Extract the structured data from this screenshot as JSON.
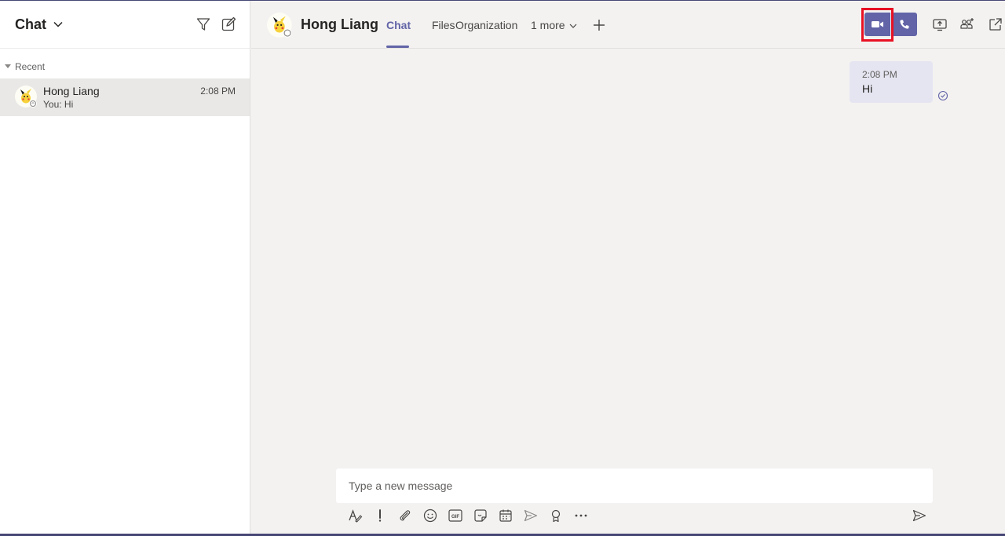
{
  "left_panel": {
    "title": "Chat",
    "section_label": "Recent",
    "conversations": [
      {
        "name": "Hong Liang",
        "preview": "You: Hi",
        "time": "2:08 PM",
        "avatar": "pikachu-avatar"
      }
    ]
  },
  "header": {
    "contact_name": "Hong Liang",
    "tabs": [
      {
        "label": "Chat",
        "active": true
      },
      {
        "label": "Files",
        "active": false
      },
      {
        "label": "Organization",
        "active": false
      },
      {
        "label": "1 more",
        "active": false
      }
    ],
    "icons": [
      "video-call-icon",
      "audio-call-icon",
      "share-screen-icon",
      "add-people-icon",
      "pop-out-icon"
    ]
  },
  "messages": [
    {
      "time": "2:08 PM",
      "text": "Hi",
      "status": "read"
    }
  ],
  "compose": {
    "placeholder": "Type a new message",
    "toolbar_icons": [
      "format-icon",
      "important-icon",
      "attach-icon",
      "emoji-icon",
      "gif-icon",
      "sticker-icon",
      "meet-now-icon",
      "stream-icon",
      "praise-icon",
      "more-options-icon",
      "send-icon"
    ]
  },
  "colors": {
    "accent": "#6264a7",
    "highlight_box": "#e81123",
    "bubble_bg": "#e5e5f1",
    "selected_row": "#e9e8e7"
  }
}
